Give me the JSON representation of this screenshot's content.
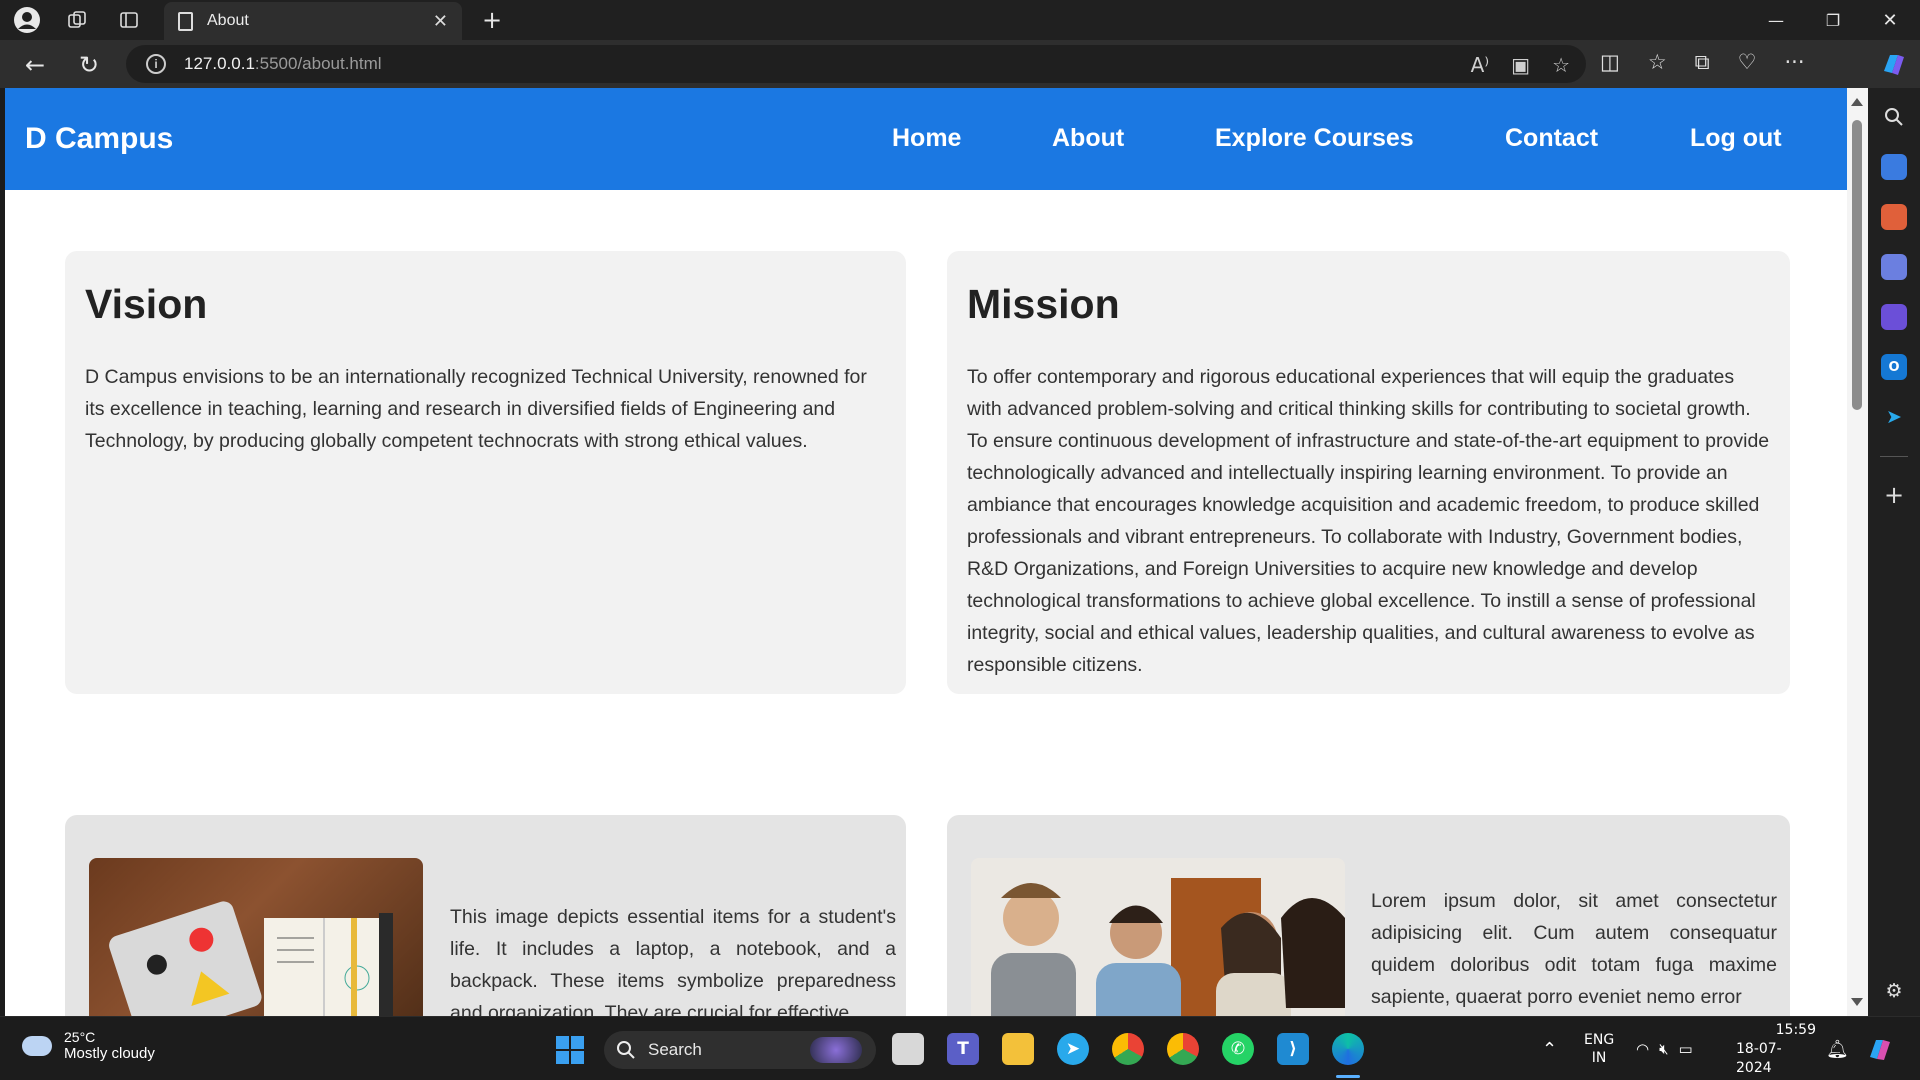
{
  "browser": {
    "tab_title": "About",
    "url_host": "127.0.0.1",
    "url_path": ":5500/about.html",
    "tab_close": "✕",
    "new_tab": "+",
    "back": "←",
    "reload": "↻",
    "minimize": "—",
    "restore": "❐",
    "close": "✕"
  },
  "site": {
    "brand": "D Campus",
    "nav": [
      "Home",
      "About",
      "Explore Courses",
      "Contact",
      "Log out"
    ],
    "accent": "#1b78e2"
  },
  "vision": {
    "heading": "Vision",
    "text": "D Campus envisions to be an internationally recognized Technical University, renowned for its excellence in teaching, learning and research in diversified fields of Engineering and Technology, by producing globally competent technocrats with strong ethical values."
  },
  "mission": {
    "heading": "Mission",
    "text": "To offer contemporary and rigorous educational experiences that will equip the graduates with advanced problem-solving and critical thinking skills for contributing to societal growth. To ensure continuous development of infrastructure and state-of-the-art equipment to provide technologically advanced and intellectually inspiring learning environment. To provide an ambiance that encourages knowledge acquisition and academic freedom, to produce skilled professionals and vibrant entrepreneurs. To collaborate with Industry, Government bodies, R&D Organizations, and Foreign Universities to acquire new knowledge and develop technological transformations to achieve global excellence. To instill a sense of professional integrity, social and ethical values, leadership qualities, and cultural awareness to evolve as responsible citizens."
  },
  "feature_left": {
    "text": "This image depicts essential items for a student's life. It includes a laptop, a notebook, and a backpack. These items symbolize preparedness and organization. They are crucial for effective"
  },
  "feature_right": {
    "text": "Lorem ipsum dolor, sit amet consectetur adipisicing elit. Cum autem consequatur quidem doloribus odit totam fuga maxime sapiente, quaerat porro eveniet nemo error"
  },
  "taskbar": {
    "temp": "25°C",
    "weather": "Mostly cloudy",
    "search": "Search",
    "lang1": "ENG",
    "lang2": "IN",
    "time": "15:59",
    "date": "18-07-2024"
  }
}
